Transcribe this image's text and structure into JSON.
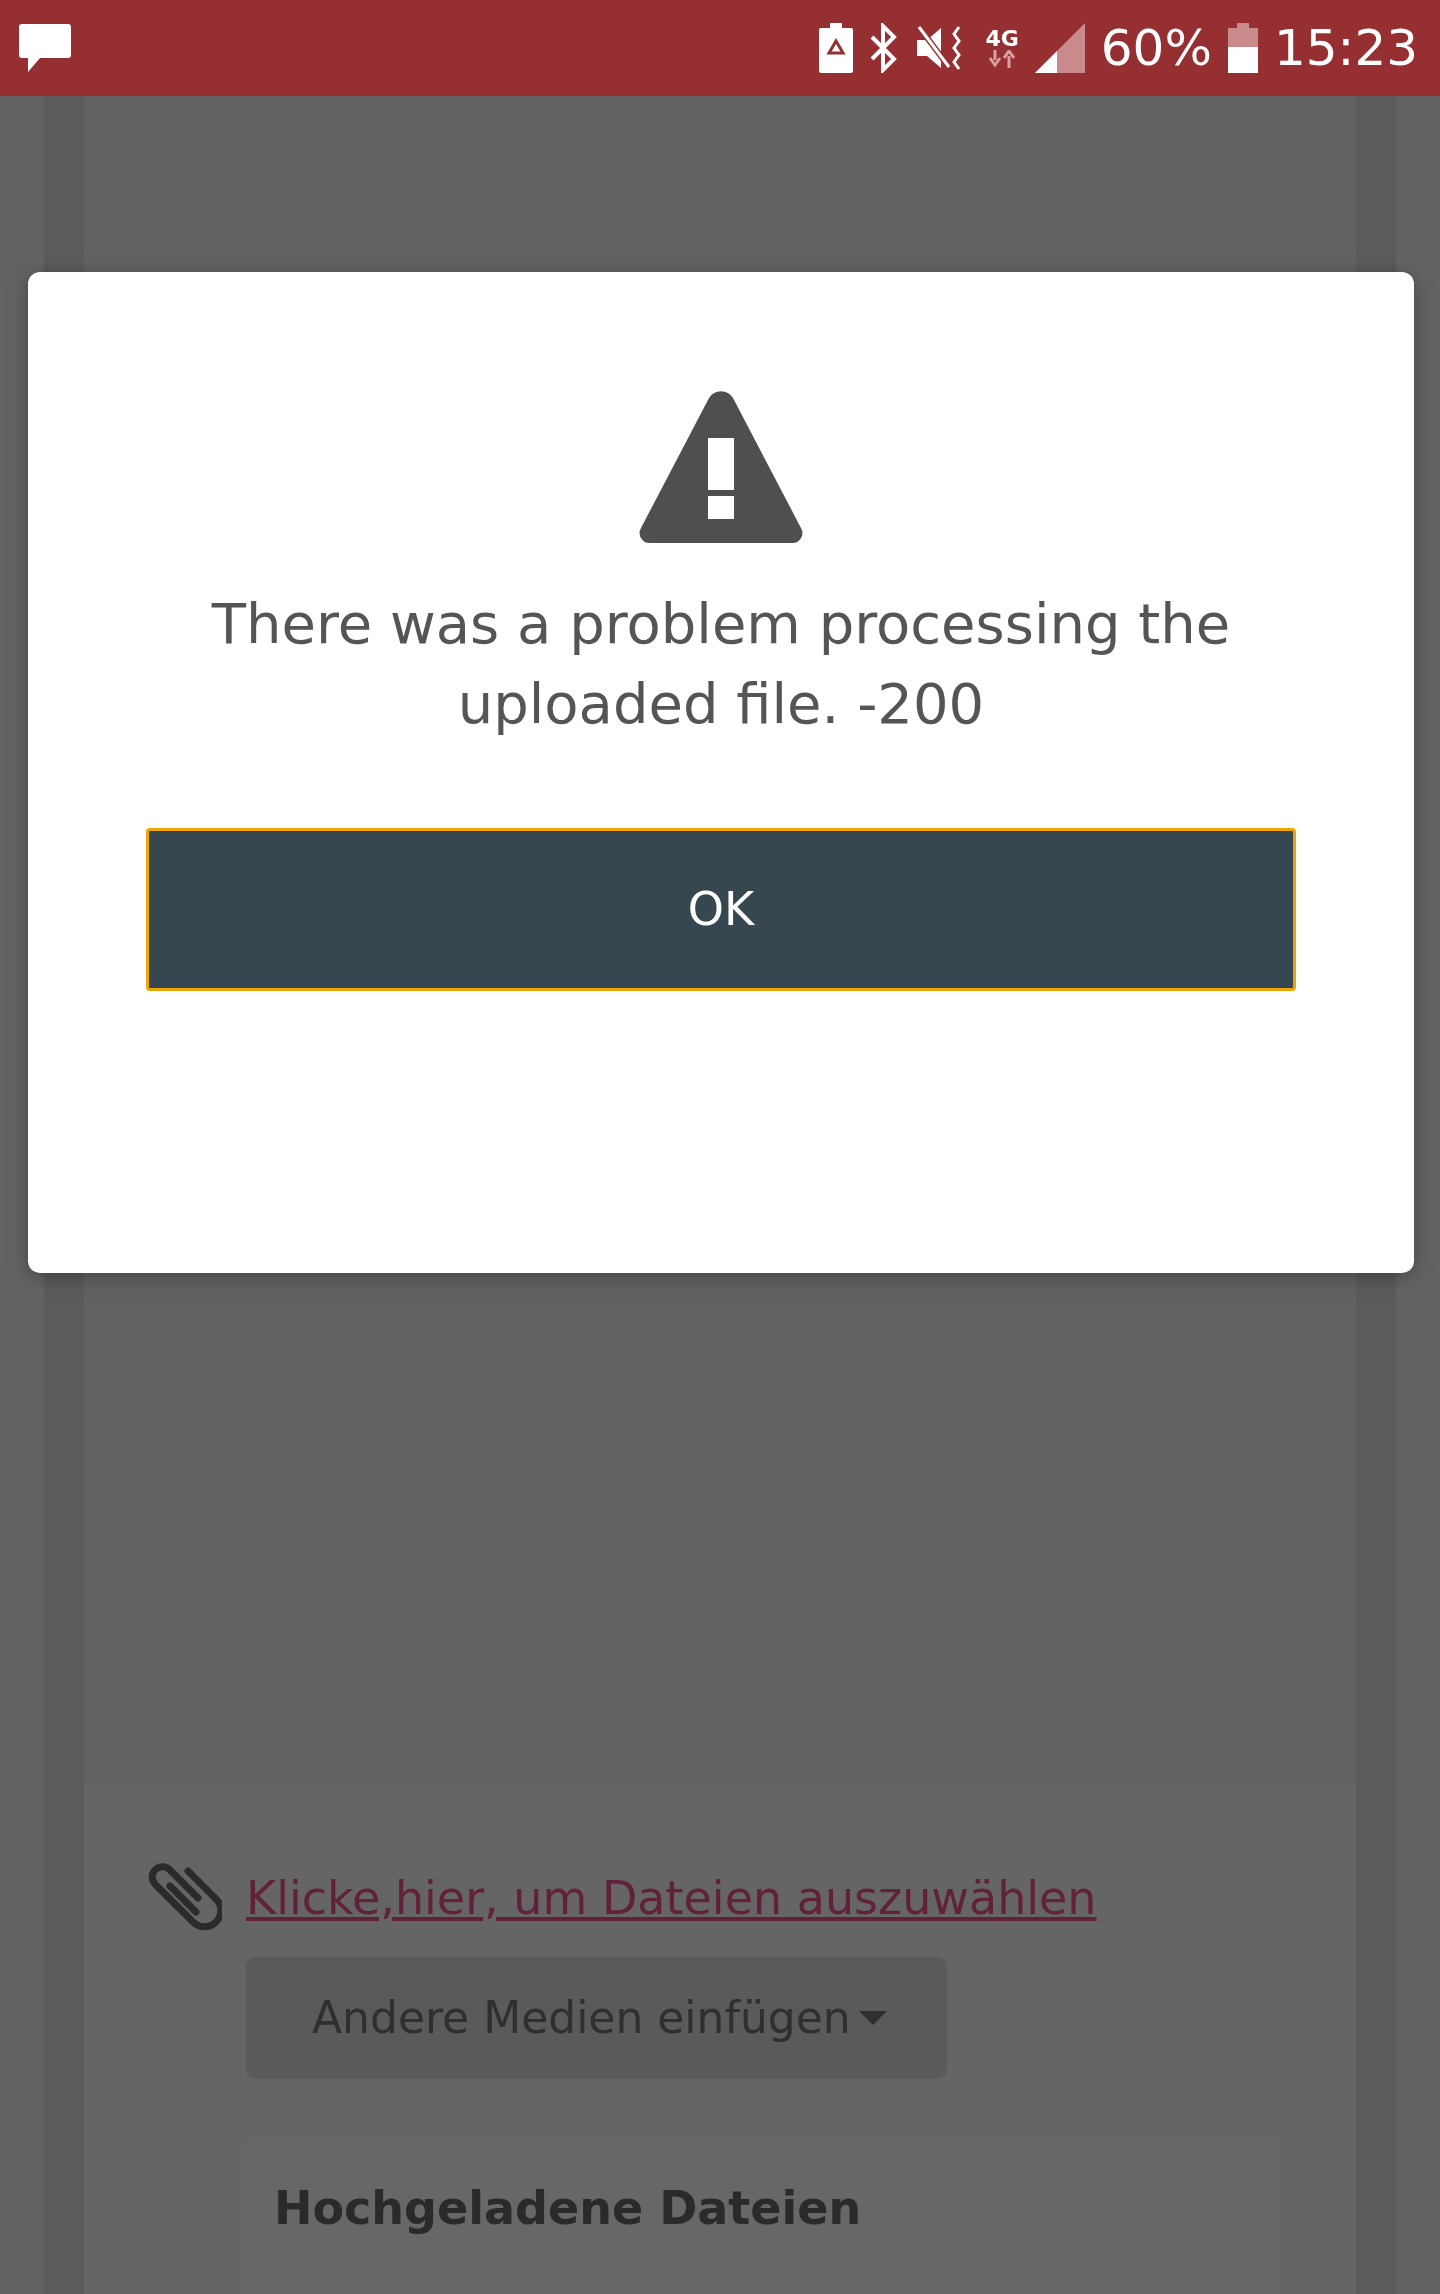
{
  "status_bar": {
    "network": "4G",
    "battery": "60%",
    "time": "15:23"
  },
  "dialog": {
    "message": "There was a problem processing the uploaded file. -200",
    "button": "OK"
  },
  "page": {
    "attach_link": "Klicke,hier, um Dateien auszuwählen",
    "media_dropdown": "Andere Medien einfügen",
    "uploaded_heading": "Hochgeladene Dateien"
  }
}
